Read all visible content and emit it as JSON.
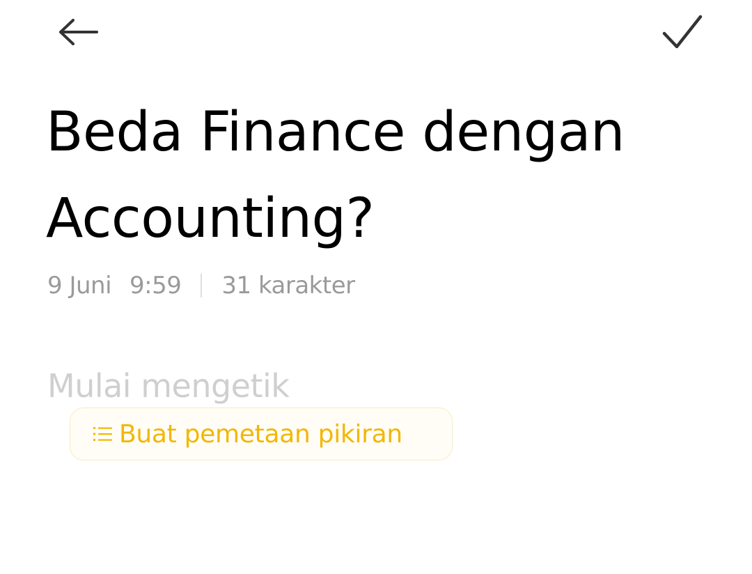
{
  "toolbar": {
    "back_icon": "arrow-left-icon",
    "confirm_icon": "checkmark-icon"
  },
  "note": {
    "title_line1": "Beda Finance dengan",
    "title_line2": "Accounting?",
    "date": "9 Juni",
    "time": "9:59",
    "char_count": "31 karakter",
    "body_placeholder": "Mulai mengetik",
    "body_value": ""
  },
  "mindmap": {
    "icon": "list-icon",
    "label": "Buat pemetaan pikiran"
  },
  "colors": {
    "accent": "#F2B705",
    "meta_text": "#9A9A9A",
    "placeholder": "#CFCFCF",
    "title_text": "#000000"
  }
}
